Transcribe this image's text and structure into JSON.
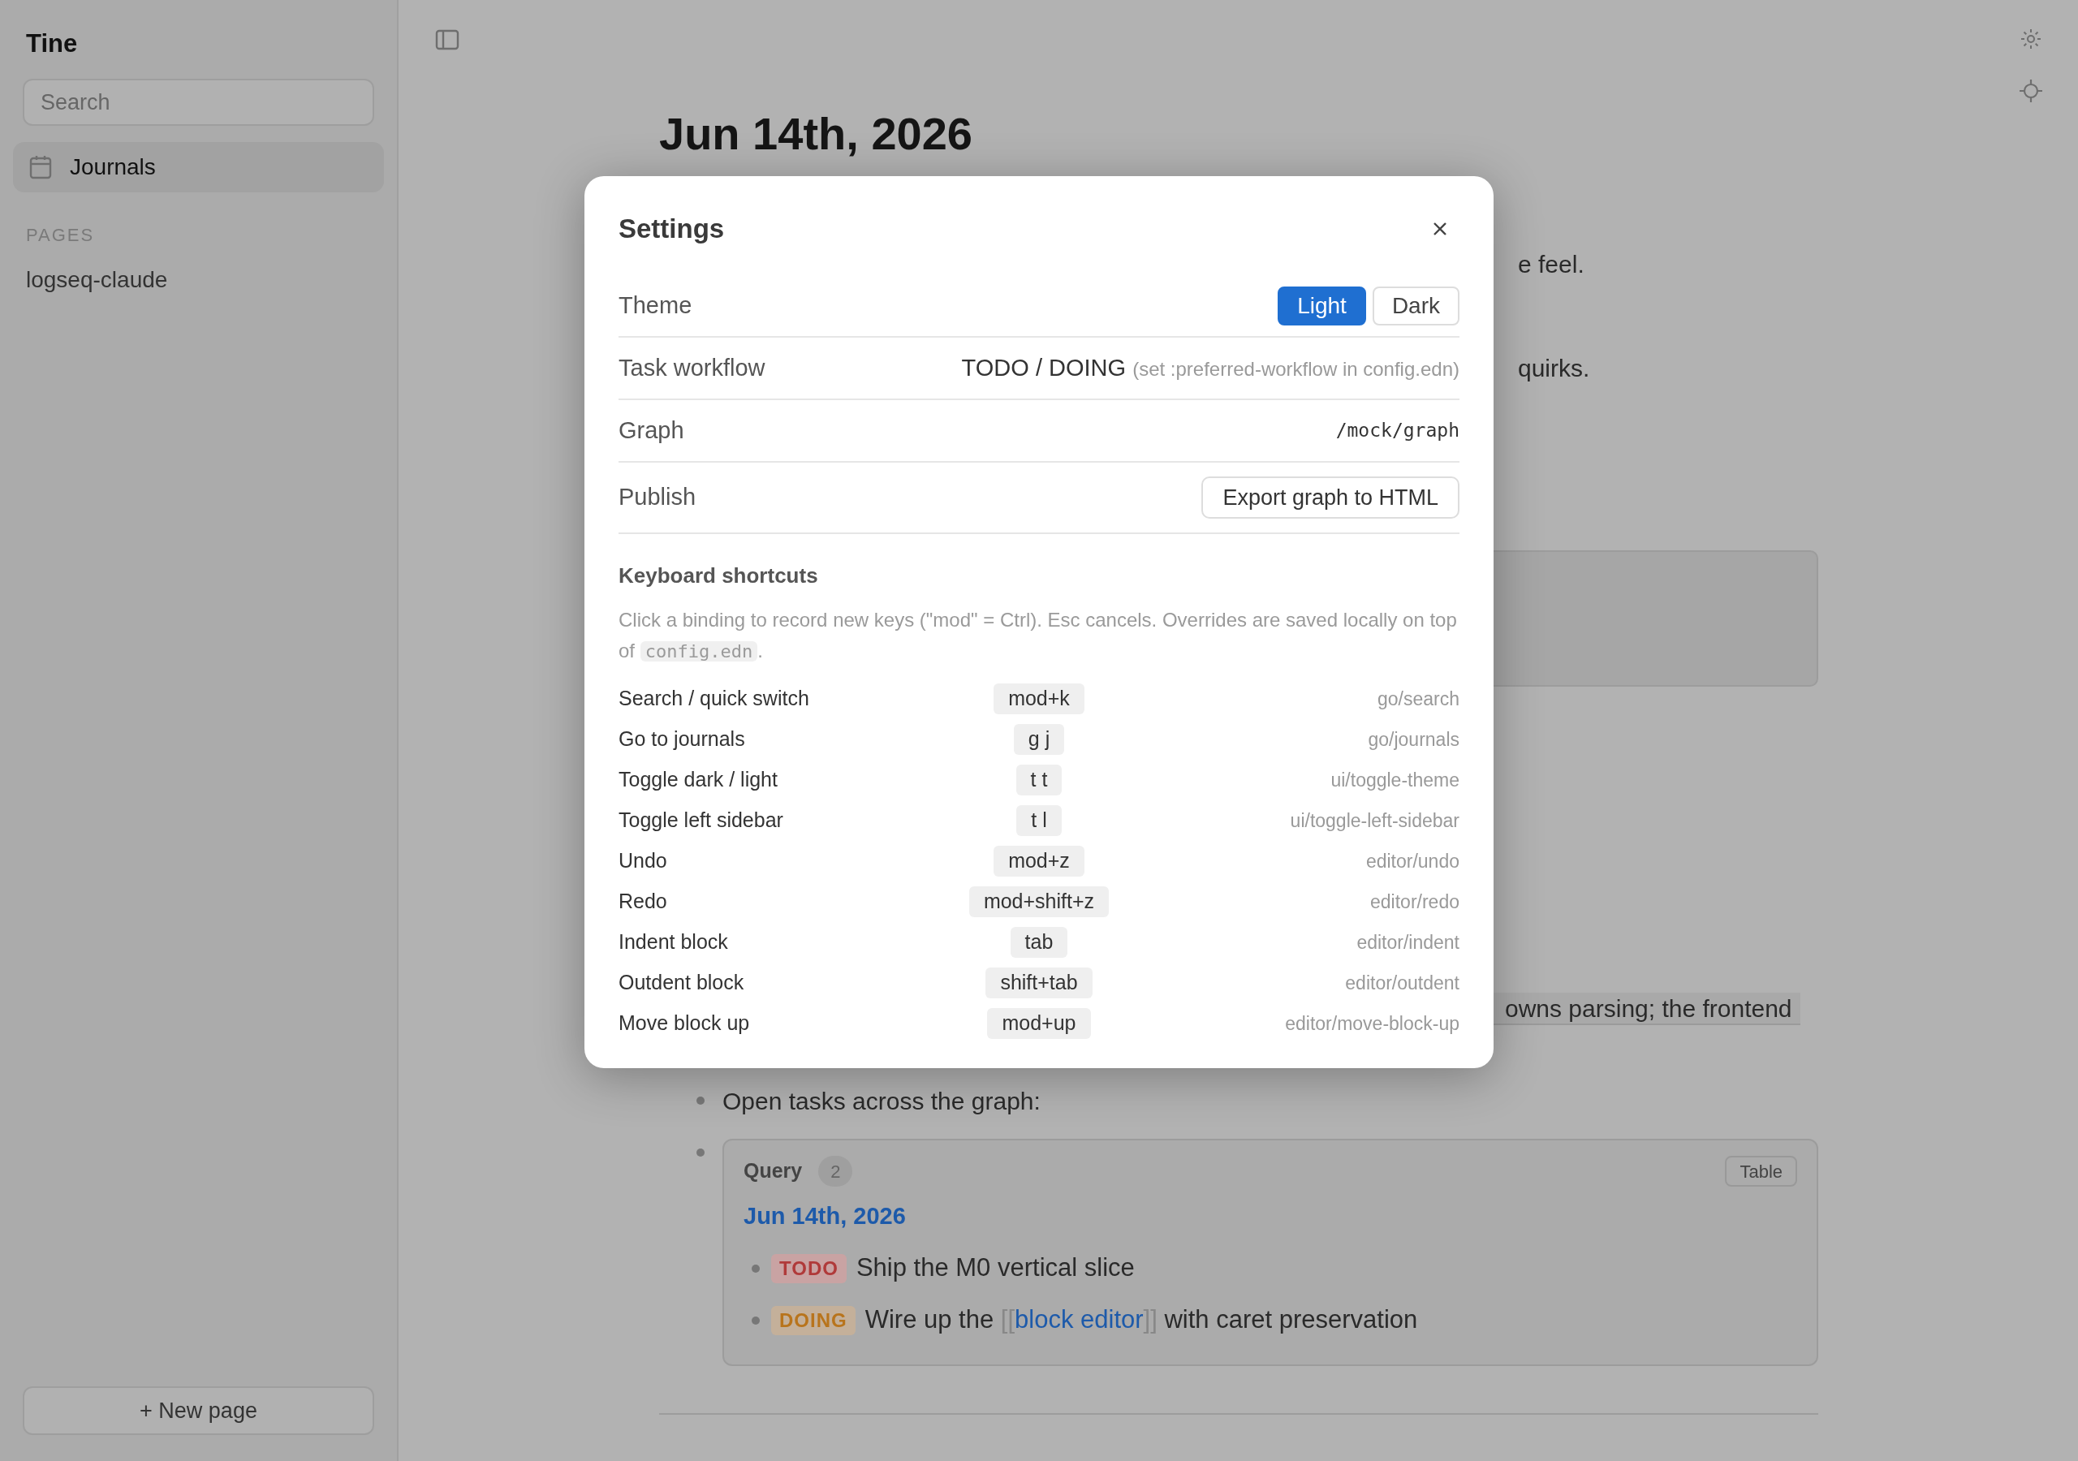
{
  "sidebar": {
    "title": "Tine",
    "search": {
      "placeholder": "Search"
    },
    "nav": [
      {
        "label": "Journals",
        "selected": true
      }
    ],
    "pages_heading": "PAGES",
    "pages": [
      {
        "label": "logseq-claude",
        "selected": false
      }
    ],
    "new_page": "+ New page"
  },
  "main": {
    "title": "Jun 14th, 2026",
    "fragments": [
      "e feel.",
      "quirks."
    ],
    "highlight_fragment": "owns parsing; the frontend",
    "open_tasks": "Open tasks across the graph:",
    "query": {
      "label": "Query",
      "count": "2",
      "view_button": "Table",
      "group": "Jun 14th, 2026",
      "items": [
        {
          "kind": "todo",
          "marker": "TODO",
          "text": "Ship the M0 vertical slice"
        },
        {
          "kind": "doing",
          "marker": "DOING",
          "text": "Wire up the ",
          "link_open": "[[",
          "link": "block editor",
          "link_close": "]]",
          "after": " with caret preservation"
        }
      ]
    }
  },
  "settings": {
    "title": "Settings",
    "rows": [
      {
        "kind": "segmented",
        "label": "Theme",
        "options": [
          {
            "label": "Light",
            "selected": true
          },
          {
            "label": "Dark",
            "selected": false
          }
        ]
      },
      {
        "kind": "note",
        "label": "Task workflow",
        "value": "TODO / DOING",
        "note": "(set :preferred-workflow in config.edn)"
      },
      {
        "kind": "code",
        "label": "Graph",
        "value": "/mock/graph"
      },
      {
        "kind": "button",
        "label": "Publish",
        "value": "Export graph to HTML"
      }
    ],
    "shortcuts": {
      "title": "Keyboard shortcuts",
      "description": "Click a binding to record new keys (\"mod\" = Ctrl). Esc cancels. Overrides are saved locally on top of ",
      "code": "config.edn",
      "description_end": ".",
      "rows": [
        {
          "label": "Search / quick switch",
          "keys": "mod+k",
          "action": "go/search"
        },
        {
          "label": "Go to journals",
          "keys": "g j",
          "action": "go/journals"
        },
        {
          "label": "Toggle dark / light",
          "keys": "t t",
          "action": "ui/toggle-theme"
        },
        {
          "label": "Toggle left sidebar",
          "keys": "t l",
          "action": "ui/toggle-left-sidebar"
        },
        {
          "label": "Undo",
          "keys": "mod+z",
          "action": "editor/undo"
        },
        {
          "label": "Redo",
          "keys": "mod+shift+z",
          "action": "editor/redo"
        },
        {
          "label": "Indent block",
          "keys": "tab",
          "action": "editor/indent"
        },
        {
          "label": "Outdent block",
          "keys": "shift+tab",
          "action": "editor/outdent"
        },
        {
          "label": "Move block up",
          "keys": "mod+up",
          "action": "editor/move-block-up"
        }
      ]
    }
  }
}
